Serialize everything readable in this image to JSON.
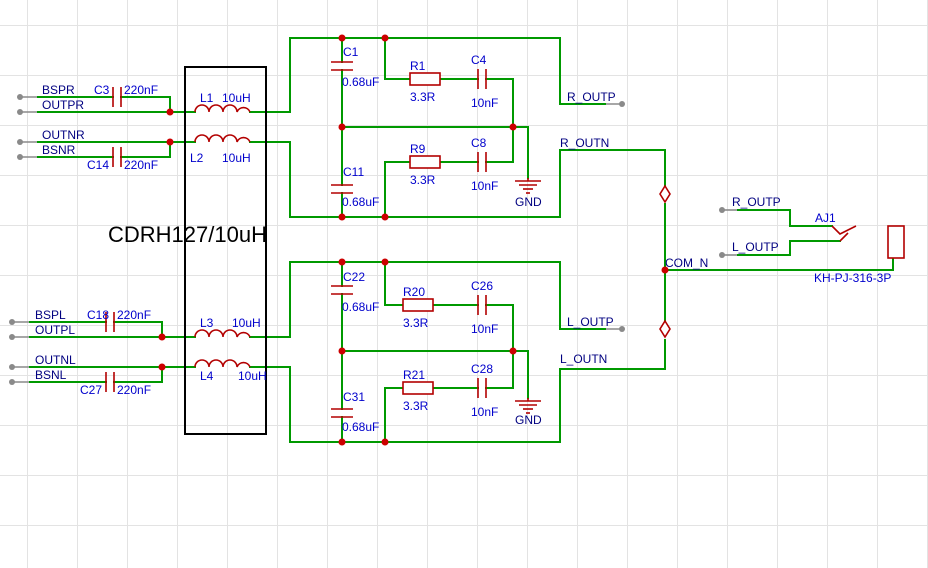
{
  "title": "CDRH127/10uH",
  "components": {
    "C3": {
      "ref": "C3",
      "value": "220nF"
    },
    "C14": {
      "ref": "C14",
      "value": "220nF"
    },
    "C18": {
      "ref": "C18",
      "value": "220nF"
    },
    "C27": {
      "ref": "C27",
      "value": "220nF"
    },
    "L1": {
      "ref": "L1",
      "value": "10uH"
    },
    "L2": {
      "ref": "L2",
      "value": "10uH"
    },
    "L3": {
      "ref": "L3",
      "value": "10uH"
    },
    "L4": {
      "ref": "L4",
      "value": "10uH"
    },
    "C1": {
      "ref": "C1",
      "value": "0.68uF"
    },
    "C11": {
      "ref": "C11",
      "value": "0.68uF"
    },
    "C22": {
      "ref": "C22",
      "value": "0.68uF"
    },
    "C31": {
      "ref": "C31",
      "value": "0.68uF"
    },
    "R1": {
      "ref": "R1",
      "value": "3.3R"
    },
    "R9": {
      "ref": "R9",
      "value": "3.3R"
    },
    "R20": {
      "ref": "R20",
      "value": "3.3R"
    },
    "R21": {
      "ref": "R21",
      "value": "3.3R"
    },
    "C4": {
      "ref": "C4",
      "value": "10nF"
    },
    "C8": {
      "ref": "C8",
      "value": "10nF"
    },
    "C26": {
      "ref": "C26",
      "value": "10nF"
    },
    "C28": {
      "ref": "C28",
      "value": "10nF"
    },
    "AJ1": {
      "ref": "AJ1",
      "value": "KH-PJ-316-3P"
    }
  },
  "nets": {
    "bspr": "BSPR",
    "outpr": "OUTPR",
    "outnr": "OUTNR",
    "bsnr": "BSNR",
    "bspl": "BSPL",
    "outpl": "OUTPL",
    "outnl": "OUTNL",
    "bsnl": "BSNL",
    "r_outp": "R_OUTP",
    "r_outn": "R_OUTN",
    "l_outp": "L_OUTP",
    "l_outn": "L_OUTN",
    "com_n": "COM_N",
    "gnd": "GND"
  }
}
